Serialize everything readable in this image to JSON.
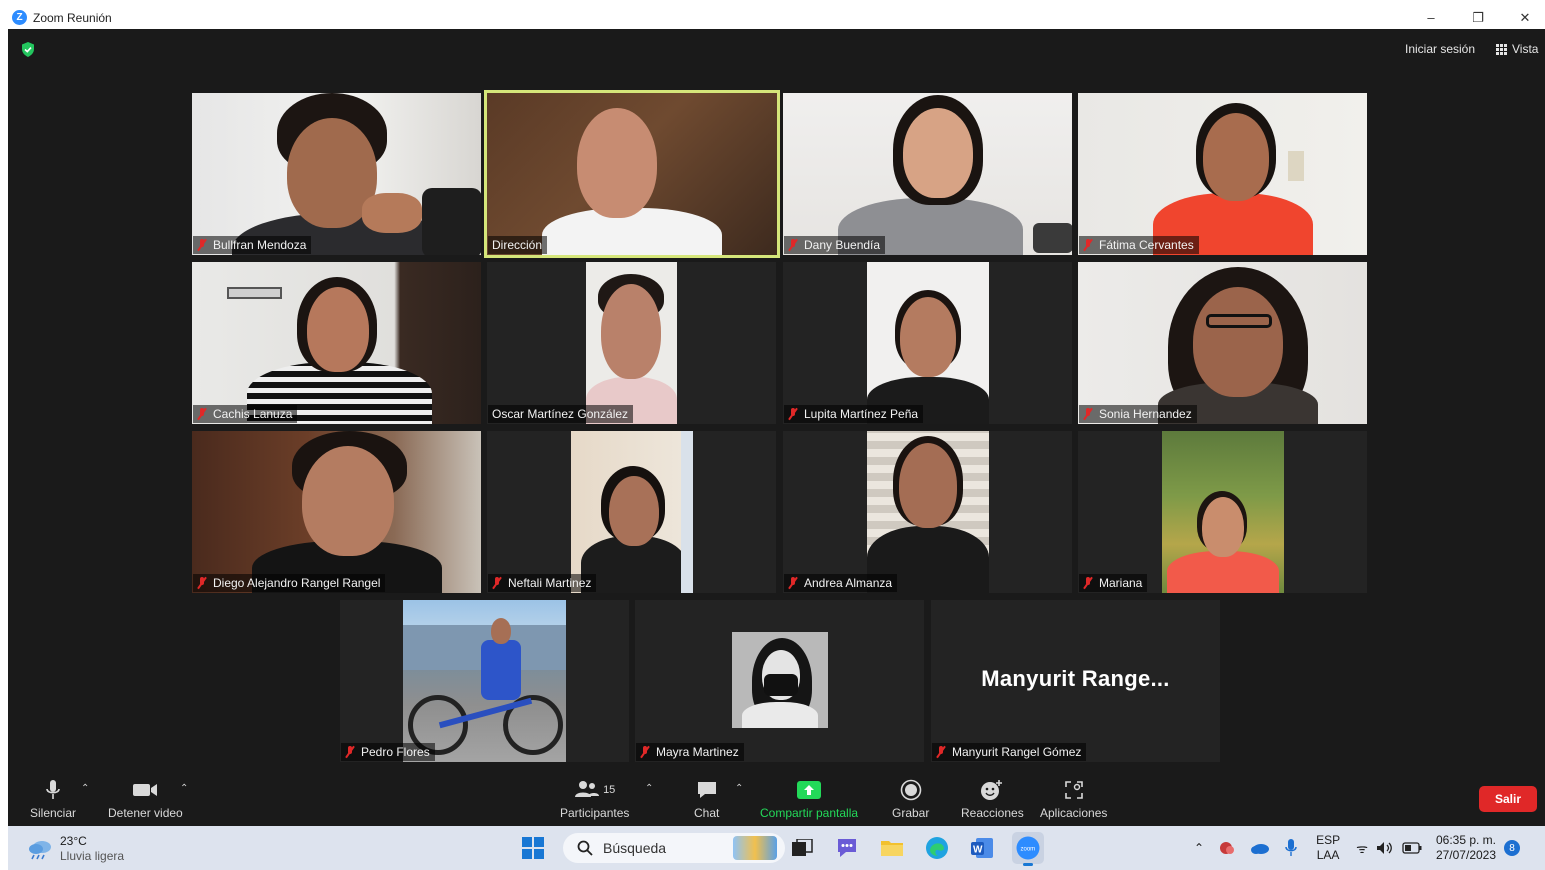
{
  "window": {
    "title": "Zoom Reunión",
    "minimize": "–",
    "restore": "❐",
    "close": "✕"
  },
  "header": {
    "signin_label": "Iniciar sesión",
    "view_label": "Vista"
  },
  "participants": [
    {
      "name": "Bullfran Mendoza",
      "muted": true
    },
    {
      "name": "Dirección",
      "muted": false,
      "active_speaker": true
    },
    {
      "name": "Dany Buendía",
      "muted": true
    },
    {
      "name": "Fátima Cervantes",
      "muted": true
    },
    {
      "name": "Cachis Lanuza",
      "muted": true
    },
    {
      "name": "Oscar Martínez González",
      "muted": false
    },
    {
      "name": "Lupita Martínez Peña",
      "muted": true
    },
    {
      "name": "Sonia Hernandez",
      "muted": true
    },
    {
      "name": "Diego Alejandro Rangel Rangel",
      "muted": true
    },
    {
      "name": "Neftali Martinez",
      "muted": true
    },
    {
      "name": "Andrea Almanza",
      "muted": true
    },
    {
      "name": "Mariana",
      "muted": true
    },
    {
      "name": "Pedro Flores",
      "muted": true
    },
    {
      "name": "Mayra Martinez",
      "muted": true
    },
    {
      "name": "Manyurit Rangel Gómez",
      "muted": true,
      "display_text": "Manyurit  Range..."
    }
  ],
  "toolbar": {
    "mute_label": "Silenciar",
    "video_label": "Detener video",
    "participants_label": "Participantes",
    "participants_count": "15",
    "chat_label": "Chat",
    "share_label": "Compartir pantalla",
    "record_label": "Grabar",
    "reactions_label": "Reacciones",
    "apps_label": "Aplicaciones",
    "leave_label": "Salir",
    "share_color": "#23d959",
    "leave_color": "#e02828"
  },
  "taskbar": {
    "temperature": "23°C",
    "weather": "Lluvia ligera",
    "search_placeholder": "Búsqueda",
    "language_line1": "ESP",
    "language_line2": "LAA",
    "time": "06:35 p. m.",
    "date": "27/07/2023",
    "notification_count": "8"
  },
  "colors": {
    "meeting_bg": "#1a1a1a",
    "tile_bg": "#232323",
    "active_border": "#d5e67a",
    "muted_red": "#e02828",
    "taskbar_bg": "#dde3ee"
  }
}
